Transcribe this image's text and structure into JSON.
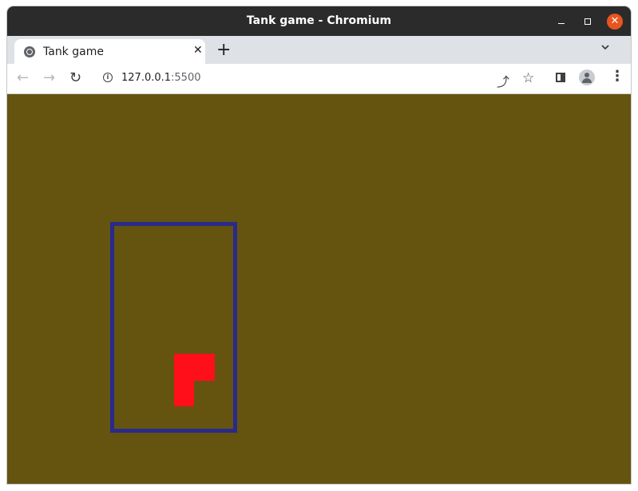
{
  "window": {
    "title": "Tank game - Chromium",
    "controls": {
      "minimize": "—",
      "maximize": "□",
      "close": "✕"
    }
  },
  "tabs": [
    {
      "title": "Tank game",
      "close": "✕",
      "active": true
    }
  ],
  "newtab": "+",
  "toolbar": {
    "back": "←",
    "forward": "→",
    "reload": "↻",
    "url_host": "127.0.0.1",
    "url_port": ":5500",
    "share": "⤴",
    "star": "☆",
    "menu": "⋮"
  },
  "game": {
    "background_color": "#645410",
    "arena_border_color": "#2a2a8a",
    "tank_color": "#ff0f1a"
  }
}
